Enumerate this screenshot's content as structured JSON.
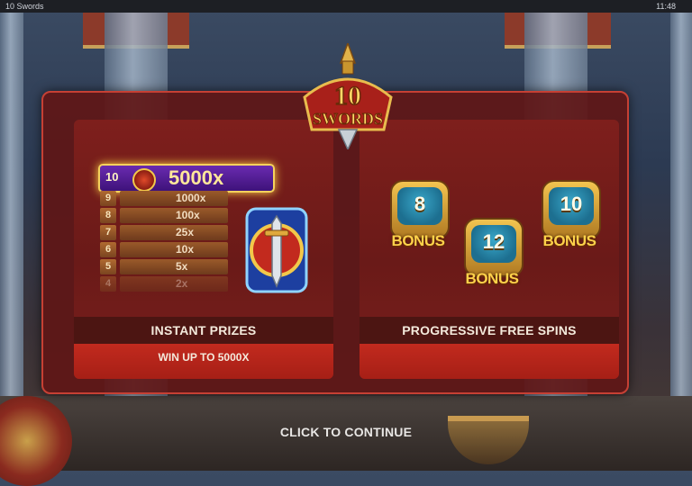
{
  "window": {
    "title": "10 Swords",
    "time": "11:48"
  },
  "logo": {
    "text_top": "10",
    "text_bottom": "SWORDS"
  },
  "ladder": {
    "top": {
      "num": "10",
      "value": "5000x"
    },
    "rungs": [
      {
        "num": "9",
        "value": "1000x"
      },
      {
        "num": "8",
        "value": "100x"
      },
      {
        "num": "7",
        "value": "25x"
      },
      {
        "num": "6",
        "value": "10x"
      },
      {
        "num": "5",
        "value": "5x"
      },
      {
        "num": "4",
        "value": "2x"
      }
    ]
  },
  "cards": {
    "left": {
      "title": "INSTANT PRIZES",
      "subtitle": "WIN UP TO 5000X"
    },
    "right": {
      "title": "PROGRESSIVE FREE SPINS"
    }
  },
  "bonuses": [
    {
      "count": "8",
      "word": "BONUS"
    },
    {
      "count": "12",
      "word": "BONUS"
    },
    {
      "count": "10",
      "word": "BONUS"
    }
  ],
  "continue_label": "CLICK TO CONTINUE",
  "colors": {
    "panel": "#601616",
    "border": "#c64034",
    "band": "#a61f16",
    "gold": "#ffd24a",
    "purple": "#4b1a8e"
  }
}
